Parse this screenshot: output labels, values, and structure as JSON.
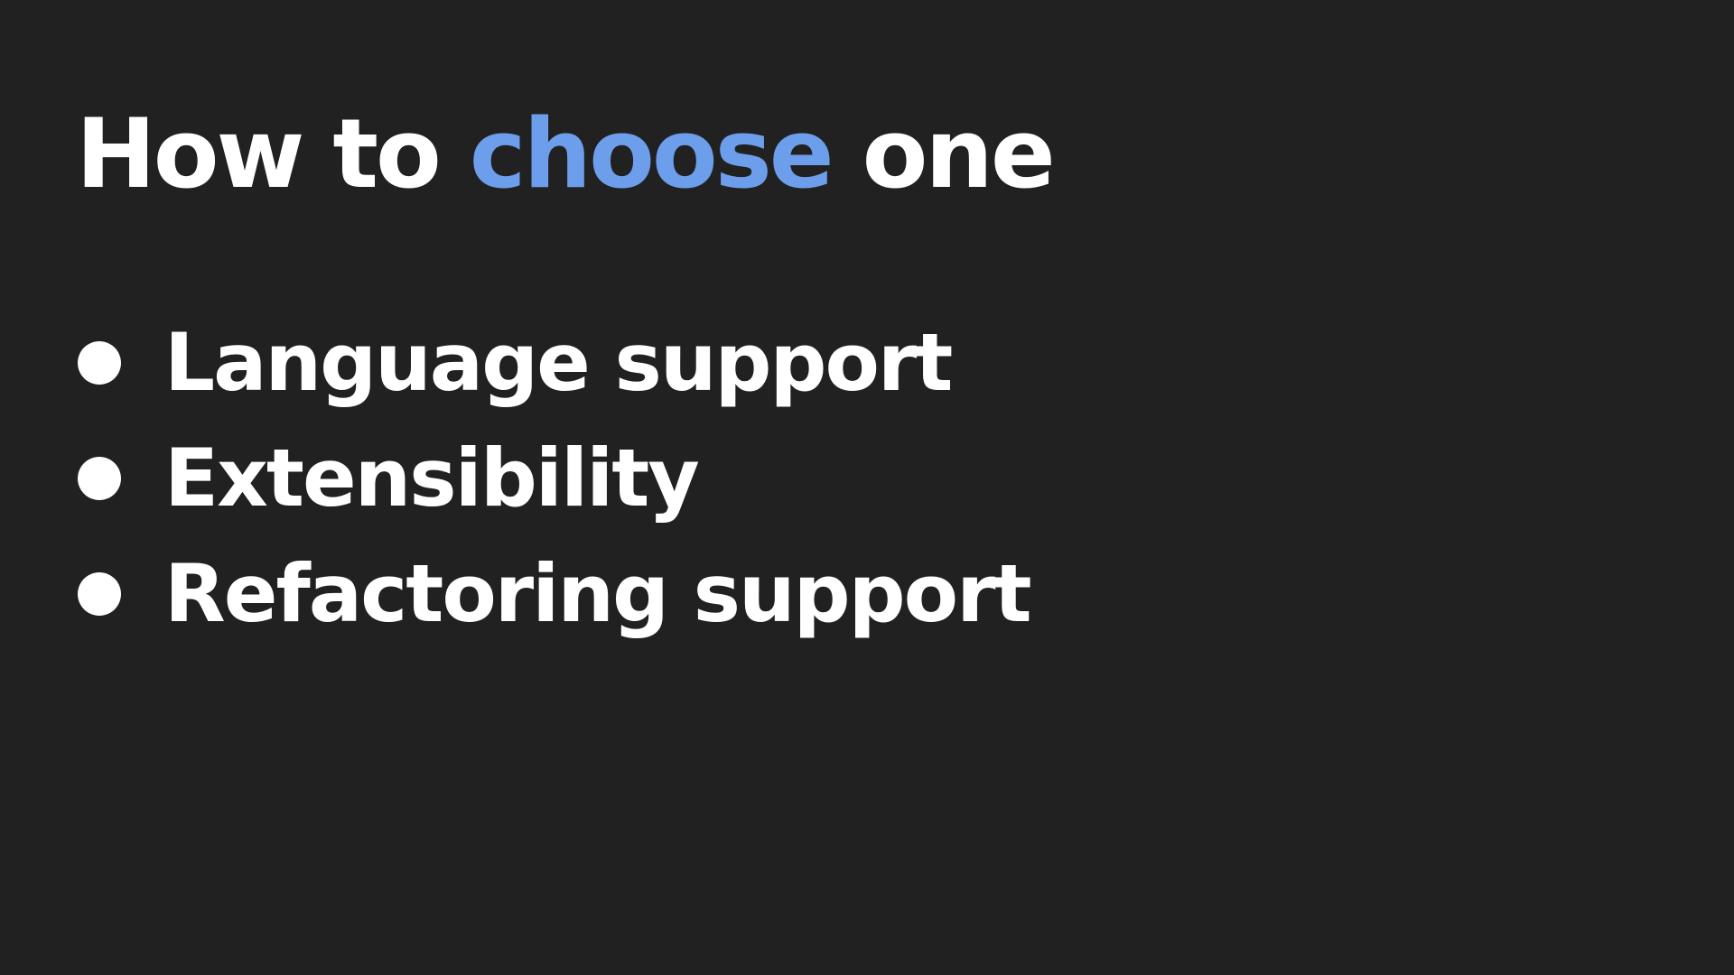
{
  "slide": {
    "title": {
      "before": "How to ",
      "accent": "choose",
      "after": " one"
    },
    "bullets": [
      "Language support",
      "Extensibility",
      "Refactoring support"
    ]
  },
  "colors": {
    "background": "#212121",
    "text": "#ffffff",
    "accent": "#6d9eeb"
  }
}
